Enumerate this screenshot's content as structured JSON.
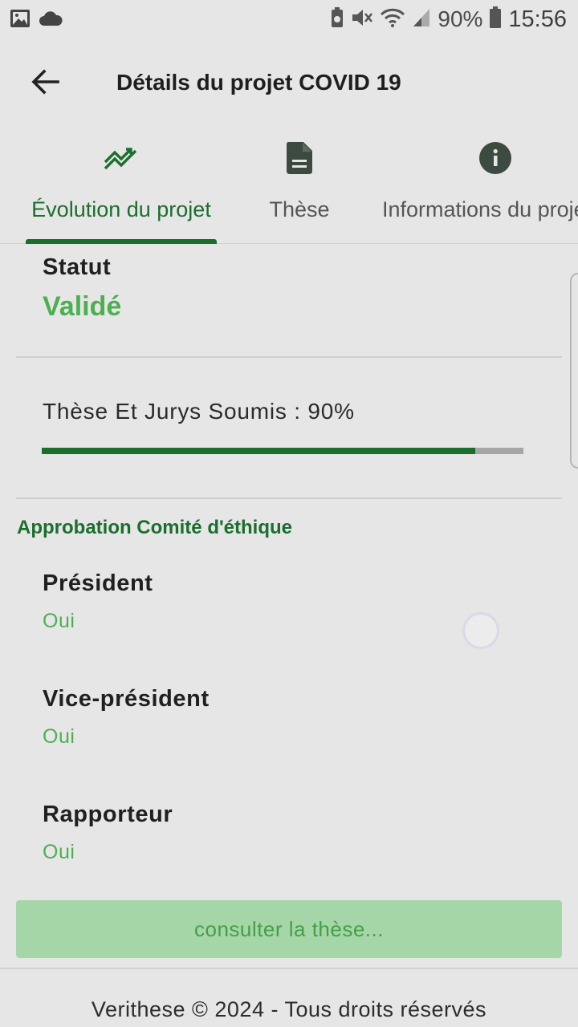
{
  "status_bar": {
    "battery": "90%",
    "time": "15:56"
  },
  "header": {
    "title": "Détails du projet COVID 19"
  },
  "tabs": [
    {
      "label": "Évolution du projet",
      "icon": "trending-up-icon",
      "active": true
    },
    {
      "label": "Thèse",
      "icon": "document-icon",
      "active": false
    },
    {
      "label": "Informations du projet",
      "icon": "info-icon",
      "active": false
    }
  ],
  "statut": {
    "label": "Statut",
    "value": "Validé"
  },
  "progress": {
    "text": "Thèse Et Jurys Soumis : 90%",
    "percent": 90
  },
  "approval": {
    "title": "Approbation Comité d'éthique",
    "items": [
      {
        "label": "Président",
        "value": "Oui"
      },
      {
        "label": "Vice-président",
        "value": "Oui"
      },
      {
        "label": "Rapporteur",
        "value": "Oui"
      }
    ]
  },
  "actions": {
    "consult_label": "consulter la thèse..."
  },
  "footer": {
    "text": "Verithese © 2024 - Tous droits réservés"
  },
  "colors": {
    "accent_dark_green": "#1b6e2d",
    "accent_green": "#4caf50",
    "button_bg": "#a5d6a7",
    "background": "#e6e6e6"
  }
}
